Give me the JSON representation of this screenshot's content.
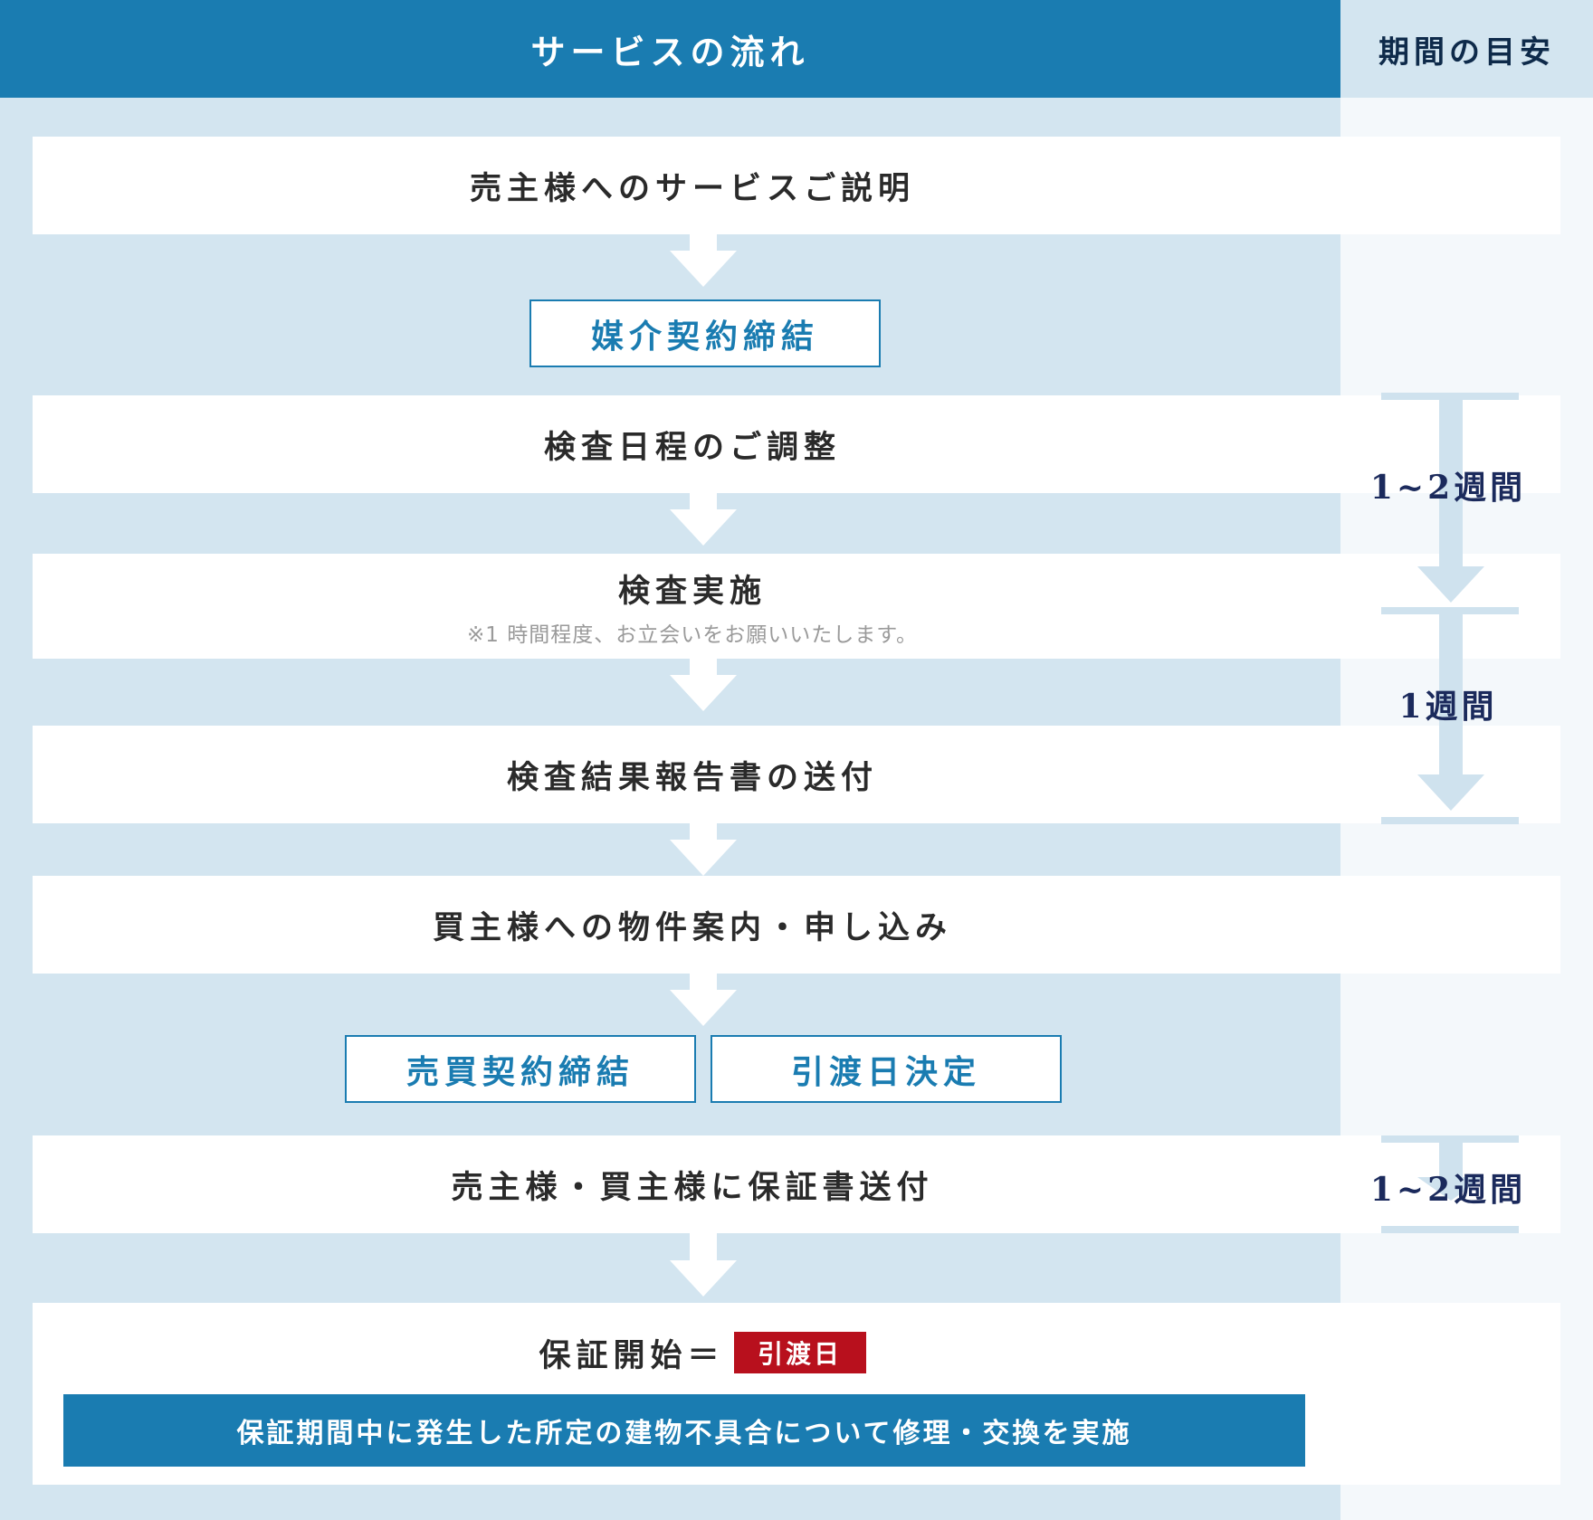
{
  "header": {
    "flow_title": "サービスの流れ",
    "period_title": "期間の目安"
  },
  "steps": [
    {
      "title": "売主様へのサービスご説明"
    },
    {
      "title": "検査日程のご調整"
    },
    {
      "title": "検査実施",
      "note": "※1 時間程度、お立会いをお願いいたします。"
    },
    {
      "title": "検査結果報告書の送付"
    },
    {
      "title": "買主様への物件案内・申し込み"
    },
    {
      "title": "売主様・買主様に保証書送付"
    }
  ],
  "milestones": {
    "brokerage": "媒介契約締結",
    "sale_contract": "売買契約締結",
    "handover_decision": "引渡日決定"
  },
  "periods": [
    "1~2週間",
    "1週間",
    "1~2週間"
  ],
  "final": {
    "prefix": "保証開始＝",
    "badge": "引渡日",
    "banner": "保証期間中に発生した所定の建物不具合について修理・交換を実施"
  },
  "colors": {
    "primary": "#1a7cb1",
    "light_band": "#d3e5f0",
    "badge_red": "#b8101d",
    "period_text": "#1b2a5c"
  }
}
